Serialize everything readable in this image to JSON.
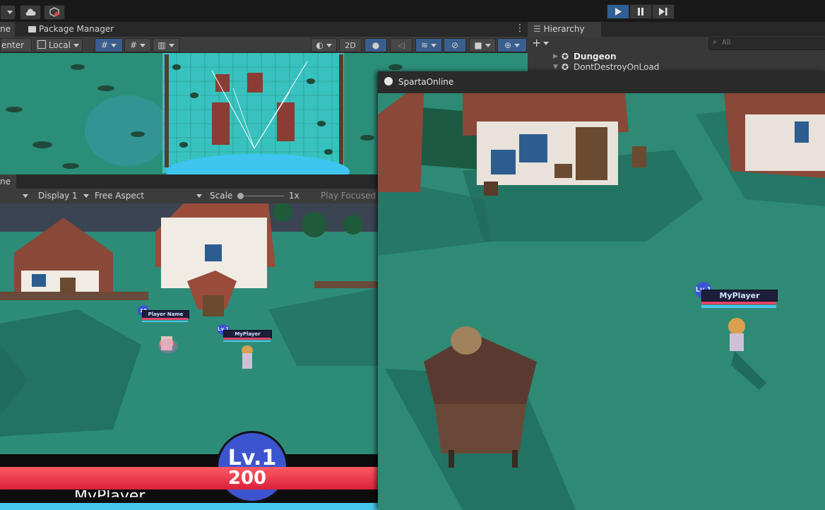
{
  "toolbar": {
    "play_icon": "play-icon",
    "pause_icon": "pause-icon",
    "step_icon": "step-icon",
    "cloud_icon": "cloud-icon",
    "collab_icon": "collab-icon"
  },
  "tabs": {
    "scene_partial": "ne",
    "package_manager": "Package Manager",
    "game_partial": "ne",
    "hierarchy": "Hierarchy"
  },
  "scene_toolbar": {
    "pivot_label": "enter",
    "space_label": "Local",
    "mode_2d": "2D"
  },
  "game_toolbar": {
    "display": "Display 1",
    "aspect": "Free Aspect",
    "scale_label": "Scale",
    "scale_value": "1x",
    "play_mode": "Play Focused"
  },
  "hierarchy": {
    "search_placeholder": "All",
    "items": [
      {
        "label": "Dungeon"
      },
      {
        "label": "DontDestroyOnLoad"
      }
    ]
  },
  "game_view": {
    "npc_level": "10",
    "npc_name": "Player Name",
    "player_level": "Lv.1",
    "player_name": "MyPlayer",
    "hud_hp": "200",
    "hud_level": "Lv.1",
    "hud_name": "MyPlayer"
  },
  "floating_window": {
    "title": "SpartaOnline",
    "player_level": "Lv.1",
    "player_name": "MyPlayer"
  },
  "colors": {
    "accent": "#3a5f8f",
    "ground": "#2e8a74",
    "hp_bar": "#e0476a",
    "mp_bar": "#46c8ee"
  }
}
